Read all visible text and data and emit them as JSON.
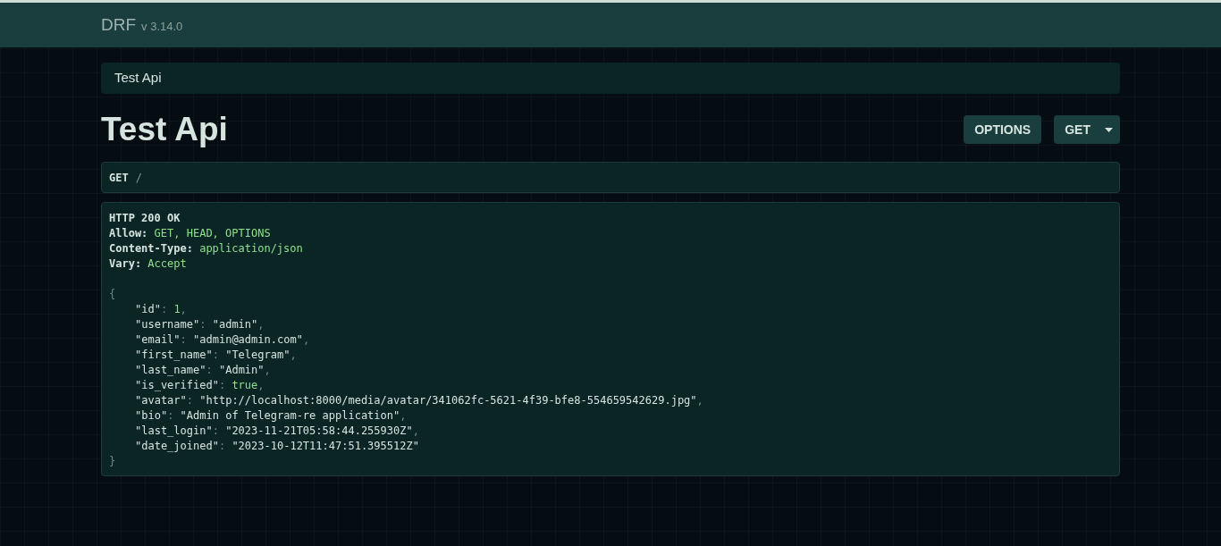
{
  "navbar": {
    "brand": "DRF",
    "version": "v 3.14.0"
  },
  "breadcrumb": {
    "label": "Test Api"
  },
  "page": {
    "title": "Test Api"
  },
  "buttons": [
    {
      "label": "OPTIONS",
      "kind": "plain"
    },
    {
      "label": "GET",
      "kind": "dropdown"
    }
  ],
  "request": {
    "method": "GET",
    "path": "/"
  },
  "response": {
    "status": "HTTP 200 OK",
    "headers": [
      {
        "name": "Allow:",
        "value": "GET, HEAD, OPTIONS"
      },
      {
        "name": "Content-Type:",
        "value": "application/json"
      },
      {
        "name": "Vary:",
        "value": "Accept"
      }
    ],
    "open": "{",
    "close": "}",
    "entries": [
      {
        "key": "\"id\"",
        "colon": ":",
        "value": "1",
        "kind": "literal",
        "comma": ","
      },
      {
        "key": "\"username\"",
        "colon": ":",
        "value": "\"admin\"",
        "kind": "string",
        "comma": ","
      },
      {
        "key": "\"email\"",
        "colon": ":",
        "value": "\"admin@admin.com\"",
        "kind": "string",
        "comma": ","
      },
      {
        "key": "\"first_name\"",
        "colon": ":",
        "value": "\"Telegram\"",
        "kind": "string",
        "comma": ","
      },
      {
        "key": "\"last_name\"",
        "colon": ":",
        "value": "\"Admin\"",
        "kind": "string",
        "comma": ","
      },
      {
        "key": "\"is_verified\"",
        "colon": ":",
        "value": "true",
        "kind": "literal",
        "comma": ","
      },
      {
        "key": "\"avatar\"",
        "colon": ":",
        "value": "\"http://localhost:8000/media/avatar/341062fc-5621-4f39-bfe8-554659542629.jpg\"",
        "kind": "string",
        "comma": ","
      },
      {
        "key": "\"bio\"",
        "colon": ":",
        "value": "\"Admin of Telegram-re application\"",
        "kind": "string",
        "comma": ","
      },
      {
        "key": "\"last_login\"",
        "colon": ":",
        "value": "\"2023-11-21T05:58:44.255930Z\"",
        "kind": "string",
        "comma": ","
      },
      {
        "key": "\"date_joined\"",
        "colon": ":",
        "value": "\"2023-10-12T11:47:51.395512Z\"",
        "kind": "string"
      }
    ]
  }
}
